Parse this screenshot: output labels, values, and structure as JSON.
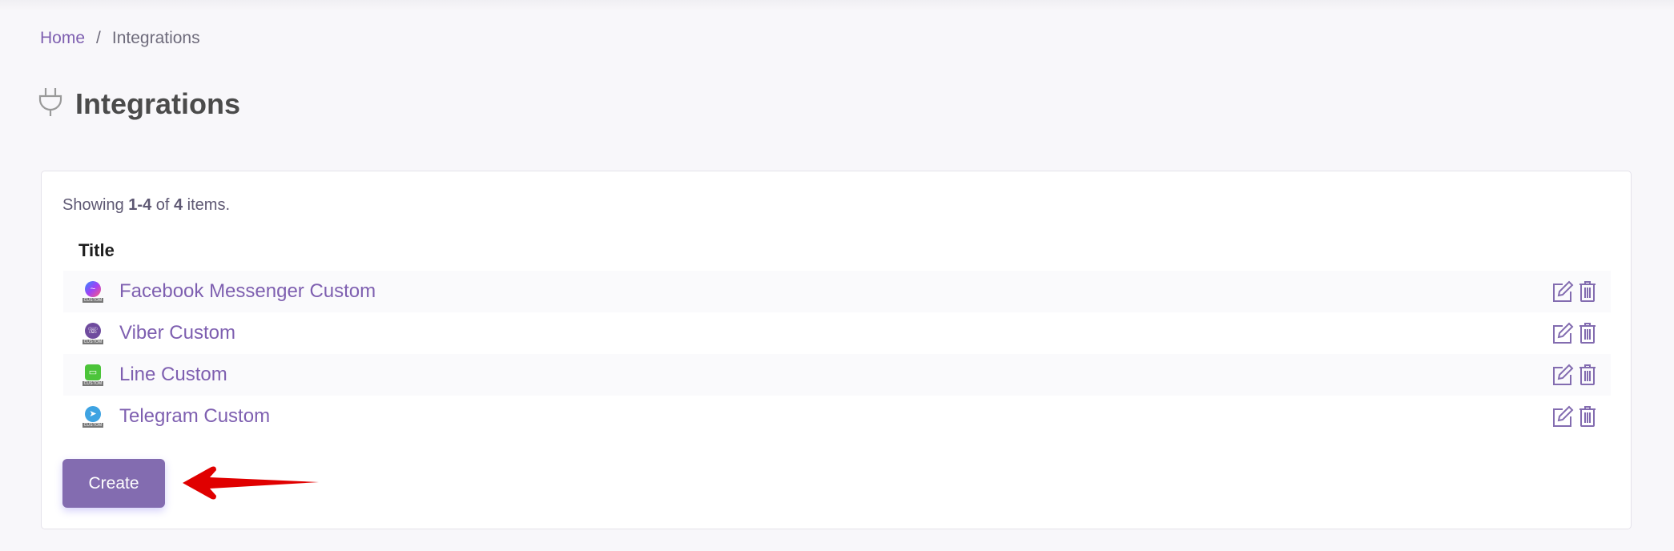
{
  "breadcrumb": {
    "home": "Home",
    "separator": "/",
    "current": "Integrations"
  },
  "page": {
    "title": "Integrations",
    "icon": "plug-icon"
  },
  "summary": {
    "prefix": "Showing ",
    "range": "1-4",
    "mid": " of ",
    "total": "4",
    "suffix": " items."
  },
  "table": {
    "header": "Title",
    "rows": [
      {
        "title": "Facebook Messenger Custom",
        "icon": "messenger-icon",
        "badge": "CUSTOM",
        "color": "#a042f5"
      },
      {
        "title": "Viber Custom",
        "icon": "viber-icon",
        "badge": "CUSTOM",
        "color": "#6f4b9e"
      },
      {
        "title": "Line Custom",
        "icon": "line-icon",
        "badge": "CUSTOM",
        "color": "#4cc43a"
      },
      {
        "title": "Telegram Custom",
        "icon": "telegram-icon",
        "badge": "CUSTOM",
        "color": "#3ea3e2"
      }
    ]
  },
  "create_label": "Create",
  "colors": {
    "accent": "#7e5fb0",
    "button": "#836cb0",
    "annotation_arrow": "#e00000"
  }
}
